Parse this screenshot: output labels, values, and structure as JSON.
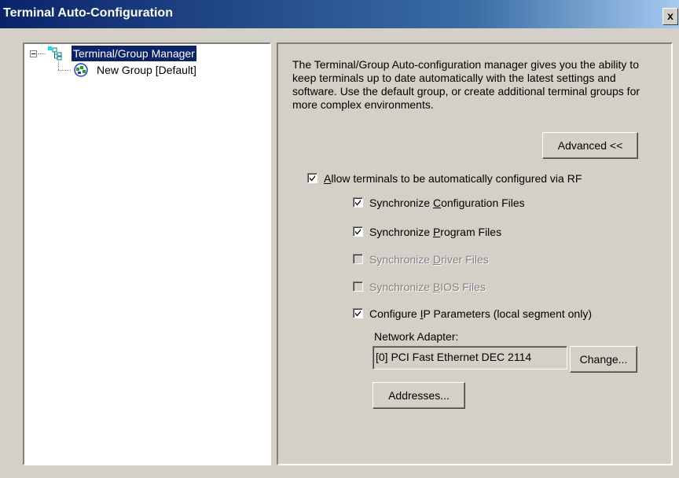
{
  "window": {
    "title": "Terminal Auto-Configuration",
    "close_label": "x"
  },
  "tree": {
    "root": {
      "label": "Terminal/Group Manager",
      "icon": "tree-structure-icon",
      "selected": true,
      "expanded": true
    },
    "children": [
      {
        "label": "New Group [Default]",
        "icon": "group-icon"
      }
    ]
  },
  "panel": {
    "description": "The Terminal/Group Auto-configuration manager gives you the ability to keep terminals up to date automatically with the latest settings and software.  Use the default group, or create additional terminal groups for more complex environments.",
    "advanced_button": "Advanced <<",
    "allow_rf": {
      "pre": "",
      "ul": "A",
      "post": "llow terminals to be automatically configured via RF",
      "checked": true,
      "enabled": true
    },
    "sync_config": {
      "pre": "Synchronize ",
      "ul": "C",
      "post": "onfiguration Files",
      "checked": true,
      "enabled": true
    },
    "sync_program": {
      "pre": "Synchronize ",
      "ul": "P",
      "post": "rogram Files",
      "checked": true,
      "enabled": true
    },
    "sync_driver": {
      "pre": "Synchronize ",
      "ul": "D",
      "post": "river Files",
      "checked": false,
      "enabled": false
    },
    "sync_bios": {
      "pre": "Synchronize ",
      "ul": "B",
      "post": "IOS Files",
      "checked": false,
      "enabled": false
    },
    "config_ip": {
      "pre": "Configure ",
      "ul": "I",
      "post": "P Parameters (local segment only)",
      "checked": true,
      "enabled": true
    },
    "network_adapter_label": "Network Adapter:",
    "network_adapter_value": "[0] PCI Fast Ethernet DEC 2114",
    "change_button": "Change...",
    "addresses_button": "Addresses..."
  }
}
